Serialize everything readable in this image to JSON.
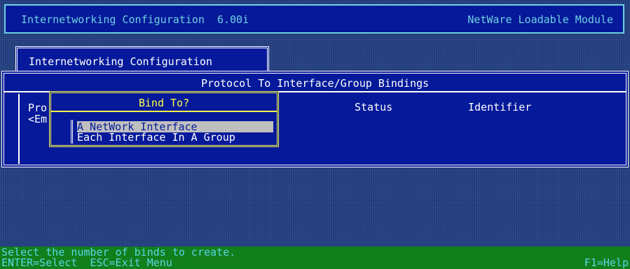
{
  "header": {
    "title": "Internetworking Configuration  6.00i",
    "module": "NetWare Loadable Module"
  },
  "config_window": {
    "title": "Internetworking Configuration"
  },
  "bindings_window": {
    "title": "Protocol To Interface/Group Bindings",
    "column_protocol": "Pro",
    "column_protocol_value": "<Em",
    "column_status": "Status",
    "column_identifier": "Identifier"
  },
  "popup": {
    "title": "Bind To?",
    "options": [
      {
        "label": "A NetWork Interface",
        "selected": true
      },
      {
        "label": "Each Interface In A Group",
        "selected": false
      }
    ]
  },
  "helpbar": {
    "message": "Select the number of binds to create.",
    "keys": "ENTER=Select  ESC=Exit Menu",
    "help": "F1=Help"
  },
  "colors": {
    "screen_blue": "#05199a",
    "header_cyan": "#6ed0e0",
    "popup_yellow": "#ffff4a",
    "selection_gray": "#bfbfbf",
    "help_green": "#117f1b"
  }
}
